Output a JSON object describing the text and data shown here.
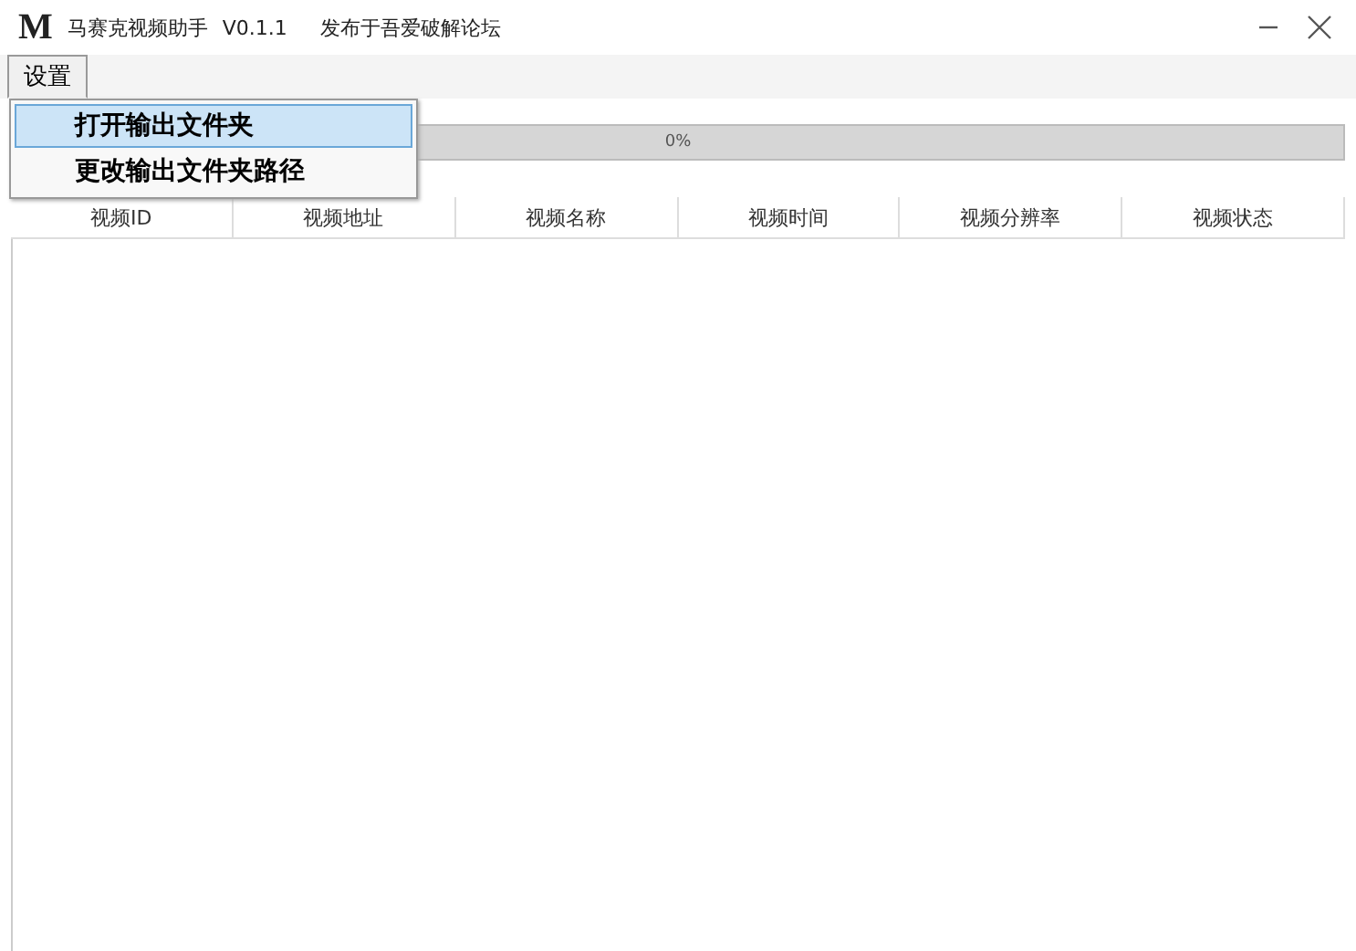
{
  "window": {
    "logo": "M",
    "title": "马赛克视频助手",
    "version": "V0.1.1",
    "subtitle": "发布于吾爱破解论坛"
  },
  "menu": {
    "label": "设置",
    "expanded": true,
    "items": [
      {
        "label": "打开输出文件夹",
        "selected": true
      },
      {
        "label": "更改输出文件夹路径",
        "selected": false
      }
    ]
  },
  "progress": {
    "level": 0,
    "reading": "0%"
  },
  "table": {
    "columns": [
      "视频ID",
      "视频地址",
      "视频名称",
      "视频时间",
      "视频分辨率",
      "视频状态"
    ]
  }
}
